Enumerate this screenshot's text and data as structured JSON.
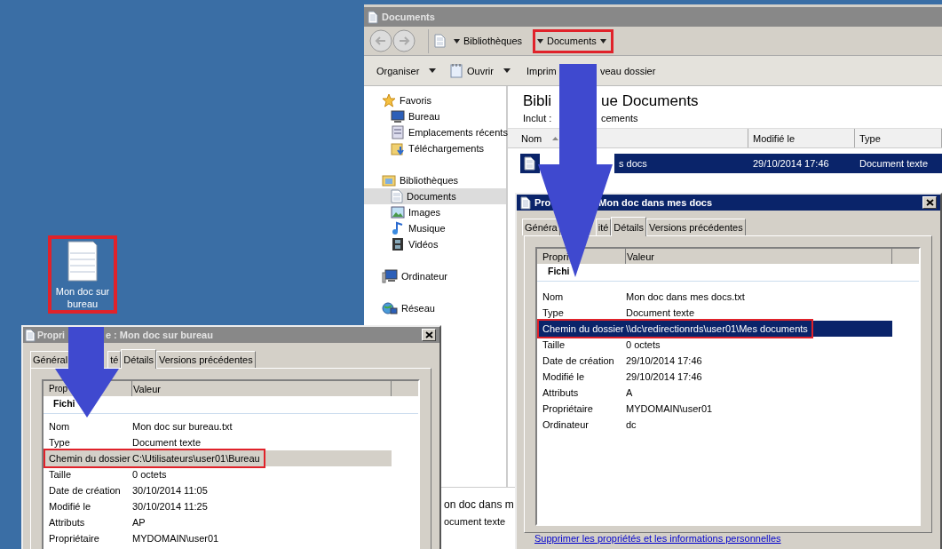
{
  "desktop": {
    "icon_label": "Mon doc sur bureau",
    "highlighted": true
  },
  "explorer": {
    "title": "Documents",
    "breadcrumb": [
      {
        "label": "Bibliothèques",
        "highlighted": false
      },
      {
        "label": "Documents",
        "highlighted": true
      }
    ],
    "toolbar": [
      {
        "label": "Organiser",
        "dropdown": true
      },
      {
        "label": "Ouvrir",
        "dropdown": true
      },
      {
        "label": "Imprim",
        "dropdown": false
      },
      {
        "label": "veau dossier",
        "dropdown": false
      }
    ],
    "nav": [
      {
        "label": "Favoris",
        "selected": false,
        "children": [
          {
            "label": "Bureau",
            "selected": false
          },
          {
            "label": "Emplacements récents",
            "selected": false
          },
          {
            "label": "Téléchargements",
            "selected": false
          }
        ]
      },
      {
        "label": "Bibliothèques",
        "selected": false,
        "children": [
          {
            "label": "Documents",
            "selected": true
          },
          {
            "label": "Images",
            "selected": false
          },
          {
            "label": "Musique",
            "selected": false
          },
          {
            "label": "Vidéos",
            "selected": false
          }
        ]
      },
      {
        "label": "Ordinateur",
        "selected": false
      },
      {
        "label": "Réseau",
        "selected": false
      }
    ],
    "heading": [
      "Bibli",
      "ue Documents"
    ],
    "subheading": [
      "Inclut :",
      "cements"
    ],
    "columns": [
      "Nom",
      "Modifié le",
      "Type"
    ],
    "rows": [
      {
        "name": "s docs",
        "modified": "29/10/2014 17:46",
        "type": "Document texte",
        "selected": true
      }
    ],
    "details": [
      "on doc dans m",
      "ocument texte"
    ]
  },
  "dialogs": [
    {
      "title": [
        "Propri",
        "e : Mon doc sur bureau"
      ],
      "active": false,
      "tabs": [
        {
          "label": "Général",
          "selected": false
        },
        {
          "label": "té",
          "selected": false
        },
        {
          "label": "Détails",
          "selected": true
        },
        {
          "label": "Versions précédentes",
          "selected": false
        }
      ],
      "columns": [
        "Prop",
        "Valeur"
      ],
      "group": "Fichi",
      "rows": [
        {
          "property": "Nom",
          "value": "Mon doc sur bureau.txt",
          "selected": false,
          "highlighted": false
        },
        {
          "property": "Type",
          "value": "Document texte",
          "selected": false,
          "highlighted": false
        },
        {
          "property": "Chemin du dossier",
          "value": "C:\\Utilisateurs\\user01\\Bureau",
          "selected": true,
          "highlighted": true
        },
        {
          "property": "Taille",
          "value": "0 octets",
          "selected": false,
          "highlighted": false
        },
        {
          "property": "Date de création",
          "value": "30/10/2014 11:05",
          "selected": false,
          "highlighted": false
        },
        {
          "property": "Modifié le",
          "value": "30/10/2014 11:25",
          "selected": false,
          "highlighted": false
        },
        {
          "property": "Attributs",
          "value": "AP",
          "selected": false,
          "highlighted": false
        },
        {
          "property": "Propriétaire",
          "value": "MYDOMAIN\\user01",
          "selected": false,
          "highlighted": false
        }
      ]
    },
    {
      "title": [
        "Pro",
        "Mon doc dans mes docs"
      ],
      "active": true,
      "tabs": [
        {
          "label": "Généra",
          "selected": false
        },
        {
          "label": "ité",
          "selected": false
        },
        {
          "label": "Détails",
          "selected": true
        },
        {
          "label": "Versions précédentes",
          "selected": false
        }
      ],
      "columns": [
        "Propri",
        "Valeur"
      ],
      "group": "Fichi",
      "rows": [
        {
          "property": "Nom",
          "value": "Mon doc dans mes docs.txt",
          "selected": false,
          "highlighted": false
        },
        {
          "property": "Type",
          "value": "Document texte",
          "selected": false,
          "highlighted": false
        },
        {
          "property": "Chemin du dossier",
          "value": "\\\\dc\\redirectionrds\\user01\\Mes documents",
          "selected": true,
          "highlighted": true
        },
        {
          "property": "Taille",
          "value": "0 octets",
          "selected": false,
          "highlighted": false
        },
        {
          "property": "Date de création",
          "value": "29/10/2014 17:46",
          "selected": false,
          "highlighted": false
        },
        {
          "property": "Modifié le",
          "value": "29/10/2014 17:46",
          "selected": false,
          "highlighted": false
        },
        {
          "property": "Attributs",
          "value": "A",
          "selected": false,
          "highlighted": false
        },
        {
          "property": "Propriétaire",
          "value": "MYDOMAIN\\user01",
          "selected": false,
          "highlighted": false
        },
        {
          "property": "Ordinateur",
          "value": "dc",
          "selected": false,
          "highlighted": false
        }
      ],
      "link": "Supprimer les propriétés et les informations personnelles"
    }
  ]
}
